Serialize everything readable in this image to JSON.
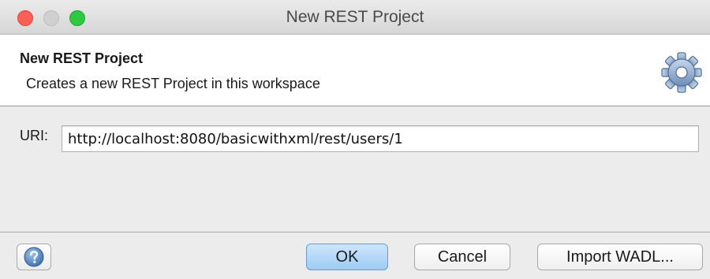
{
  "window": {
    "title": "New REST Project"
  },
  "header": {
    "title": "New REST Project",
    "description": "Creates a new REST Project in this workspace",
    "icon": "gear-icon"
  },
  "form": {
    "uri_label": "URI:",
    "uri_value": "http://localhost:8080/basicwithxml/rest/users/1"
  },
  "footer": {
    "help_icon": "help-icon",
    "ok_label": "OK",
    "cancel_label": "Cancel",
    "import_label": "Import WADL..."
  },
  "colors": {
    "close": "#fc5f57",
    "minimize": "#d0d0d0",
    "maximize": "#2ec842",
    "default_button": "#9ccbf4",
    "header_bg": "#ffffff",
    "dialog_bg": "#ececec"
  }
}
